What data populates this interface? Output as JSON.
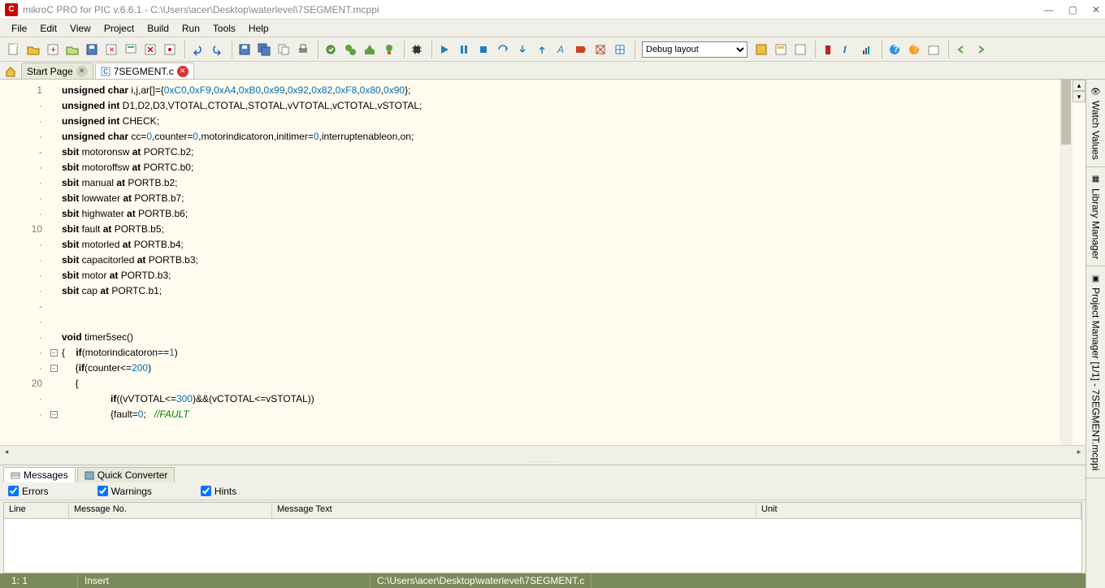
{
  "title": "mikroC PRO for PIC v.6.6.1 - C:\\Users\\acer\\Desktop\\waterlevel\\7SEGMENT.mcppi",
  "app_icon_letter": "C",
  "menu": {
    "file": "File",
    "edit": "Edit",
    "view": "View",
    "project": "Project",
    "build": "Build",
    "run": "Run",
    "tools": "Tools",
    "help": "Help"
  },
  "layout_selected": "Debug layout",
  "tabs": {
    "start": "Start Page",
    "file": "7SEGMENT.c"
  },
  "gutter": [
    "1",
    "·",
    "·",
    "·",
    "-",
    "·",
    "·",
    "·",
    "·",
    "10",
    "·",
    "·",
    "·",
    "·",
    "-",
    "·",
    "·",
    "·",
    "·",
    "20",
    "·",
    "·"
  ],
  "fold": [
    "",
    "",
    "",
    "",
    "",
    "",
    "",
    "",
    "",
    "",
    "",
    "",
    "",
    "",
    "",
    "",
    "",
    "box",
    "box",
    "",
    "",
    "box"
  ],
  "code": [
    [
      [
        "kw",
        "unsigned char"
      ],
      [
        "",
        " i,j,ar[]={"
      ],
      [
        "num",
        "0xC0"
      ],
      [
        "",
        ","
      ],
      [
        "num",
        "0xF9"
      ],
      [
        "",
        ","
      ],
      [
        "num",
        "0xA4"
      ],
      [
        "",
        ","
      ],
      [
        "num",
        "0xB0"
      ],
      [
        "",
        ","
      ],
      [
        "num",
        "0x99"
      ],
      [
        "",
        ","
      ],
      [
        "num",
        "0x92"
      ],
      [
        "",
        ","
      ],
      [
        "num",
        "0x82"
      ],
      [
        "",
        ","
      ],
      [
        "num",
        "0xF8"
      ],
      [
        "",
        ","
      ],
      [
        "num",
        "0x80"
      ],
      [
        "",
        ","
      ],
      [
        "num",
        "0x90"
      ],
      [
        "",
        "};"
      ]
    ],
    [
      [
        "kw",
        "unsigned int"
      ],
      [
        "",
        " D1,D2,D3,VTOTAL,CTOTAL,STOTAL,vVTOTAL,vCTOTAL,vSTOTAL;"
      ]
    ],
    [
      [
        "kw",
        "unsigned int"
      ],
      [
        "",
        " CHECK;"
      ]
    ],
    [
      [
        "kw",
        "unsigned char"
      ],
      [
        "",
        " cc="
      ],
      [
        "num",
        "0"
      ],
      [
        "",
        ",counter="
      ],
      [
        "num",
        "0"
      ],
      [
        "",
        ",motorindicatoron,initimer="
      ],
      [
        "num",
        "0"
      ],
      [
        "",
        ",interruptenableon,on;"
      ]
    ],
    [
      [
        "kw",
        "sbit"
      ],
      [
        "",
        " motoronsw "
      ],
      [
        "kw",
        "at"
      ],
      [
        "",
        " PORTC.b2;"
      ]
    ],
    [
      [
        "kw",
        "sbit"
      ],
      [
        "",
        " motoroffsw "
      ],
      [
        "kw",
        "at"
      ],
      [
        "",
        " PORTC.b0;"
      ]
    ],
    [
      [
        "kw",
        "sbit"
      ],
      [
        "",
        " manual "
      ],
      [
        "kw",
        "at"
      ],
      [
        "",
        " PORTB.b2;"
      ]
    ],
    [
      [
        "kw",
        "sbit"
      ],
      [
        "",
        " lowwater "
      ],
      [
        "kw",
        "at"
      ],
      [
        "",
        " PORTB.b7;"
      ]
    ],
    [
      [
        "kw",
        "sbit"
      ],
      [
        "",
        " highwater "
      ],
      [
        "kw",
        "at"
      ],
      [
        "",
        " PORTB.b6;"
      ]
    ],
    [
      [
        "kw",
        "sbit"
      ],
      [
        "",
        " fault "
      ],
      [
        "kw",
        "at"
      ],
      [
        "",
        " PORTB.b5;"
      ]
    ],
    [
      [
        "kw",
        "sbit"
      ],
      [
        "",
        " motorled "
      ],
      [
        "kw",
        "at"
      ],
      [
        "",
        " PORTB.b4;"
      ]
    ],
    [
      [
        "kw",
        "sbit"
      ],
      [
        "",
        " capacitorled "
      ],
      [
        "kw",
        "at"
      ],
      [
        "",
        " PORTB.b3;"
      ]
    ],
    [
      [
        "kw",
        "sbit"
      ],
      [
        "",
        " motor "
      ],
      [
        "kw",
        "at"
      ],
      [
        "",
        " PORTD.b3;"
      ]
    ],
    [
      [
        "kw",
        "sbit"
      ],
      [
        "",
        " cap "
      ],
      [
        "kw",
        "at"
      ],
      [
        "",
        " PORTC.b1;"
      ]
    ],
    [
      [
        "",
        ""
      ]
    ],
    [
      [
        "",
        ""
      ]
    ],
    [
      [
        "kw",
        "void"
      ],
      [
        "",
        " timer5sec()"
      ]
    ],
    [
      [
        "",
        "{    "
      ],
      [
        "kw",
        "if"
      ],
      [
        "",
        "(motorindicatoron=="
      ],
      [
        "num",
        "1"
      ],
      [
        "",
        ")"
      ]
    ],
    [
      [
        "",
        "     {"
      ],
      [
        "kw",
        "if"
      ],
      [
        "",
        "(counter<="
      ],
      [
        "num",
        "200"
      ],
      [
        "",
        ")"
      ]
    ],
    [
      [
        "",
        "     {"
      ]
    ],
    [
      [
        "",
        "                  "
      ],
      [
        "kw",
        "if"
      ],
      [
        "",
        "((vVTOTAL<="
      ],
      [
        "num",
        "300"
      ],
      [
        "",
        ")&&(vCTOTAL<=vSTOTAL))"
      ]
    ],
    [
      [
        "",
        "                  {fault="
      ],
      [
        "num",
        "0"
      ],
      [
        "",
        ";   "
      ],
      [
        "cmt",
        "//FAULT"
      ]
    ]
  ],
  "bottom_tabs": {
    "messages": "Messages",
    "quick": "Quick Converter"
  },
  "filters": {
    "errors": "Errors",
    "warnings": "Warnings",
    "hints": "Hints"
  },
  "msg_cols": {
    "line": "Line",
    "no": "Message No.",
    "text": "Message Text",
    "unit": "Unit"
  },
  "status": {
    "pos": "1: 1",
    "mode": "Insert",
    "path": "C:\\Users\\acer\\Desktop\\waterlevel\\7SEGMENT.c"
  },
  "dock": {
    "watch": "Watch Values",
    "lib": "Library Manager",
    "proj": "Project Manager [1/1] - 7SEGMENT.mcppi"
  }
}
